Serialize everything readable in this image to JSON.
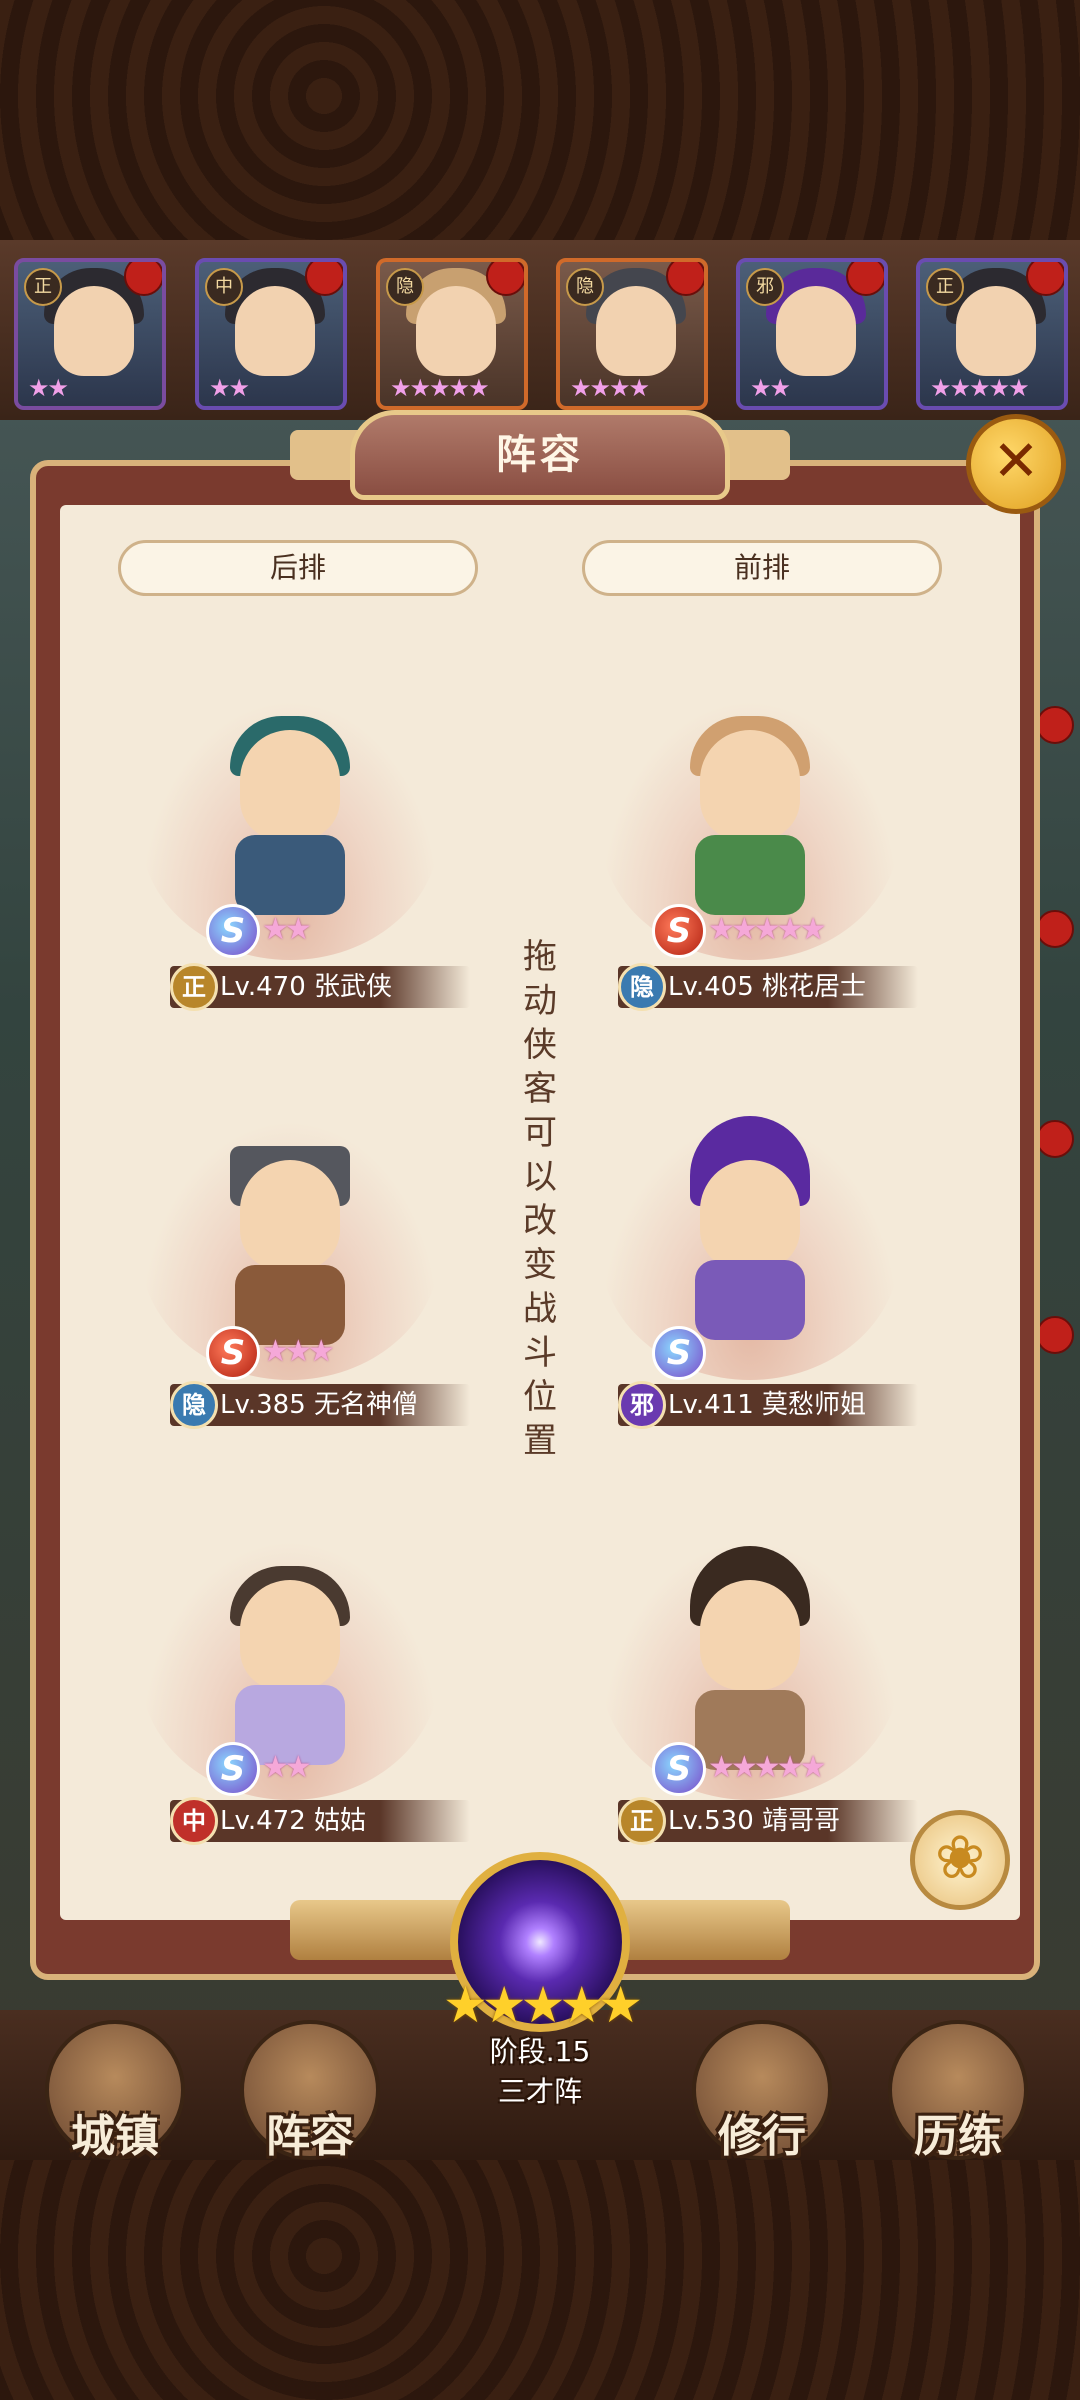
{
  "panel": {
    "title": "阵容",
    "close_icon": "✕"
  },
  "columns": {
    "back": "后排",
    "front": "前排"
  },
  "hint": "拖动侠客可以改变战斗位置",
  "roster": [
    {
      "faction": "正",
      "stars": "★★"
    },
    {
      "faction": "中",
      "stars": "★★"
    },
    {
      "faction": "隐",
      "stars": "★★★★★"
    },
    {
      "faction": "隐",
      "stars": "★★★★"
    },
    {
      "faction": "邪",
      "stars": "★★"
    },
    {
      "faction": "正",
      "stars": "★★★★★"
    }
  ],
  "heroes": [
    {
      "faction": "正",
      "level": "Lv.470",
      "name": "张武侠",
      "grade": "S",
      "stars": "★★"
    },
    {
      "faction": "隐",
      "level": "Lv.405",
      "name": "桃花居士",
      "grade": "S",
      "stars": "★★★★★"
    },
    {
      "faction": "隐",
      "level": "Lv.385",
      "name": "无名神僧",
      "grade": "S",
      "stars": "★★★"
    },
    {
      "faction": "邪",
      "level": "Lv.411",
      "name": "莫愁师姐",
      "grade": "S",
      "stars": ""
    },
    {
      "faction": "中",
      "level": "Lv.472",
      "name": "姑姑",
      "grade": "S",
      "stars": "★★"
    },
    {
      "faction": "正",
      "level": "Lv.530",
      "name": "靖哥哥",
      "grade": "S",
      "stars": "★★★★★"
    }
  ],
  "formation": {
    "stars": "★★★★★",
    "stage": "阶段.15",
    "name": "三才阵"
  },
  "nav": [
    {
      "label": "城镇"
    },
    {
      "label": "阵容"
    },
    {
      "label": "修行"
    },
    {
      "label": "历练"
    }
  ],
  "colors": {
    "panel_bg": "#f4ead9",
    "frame": "#7a3a2e",
    "accent_gold": "#e0b040"
  }
}
